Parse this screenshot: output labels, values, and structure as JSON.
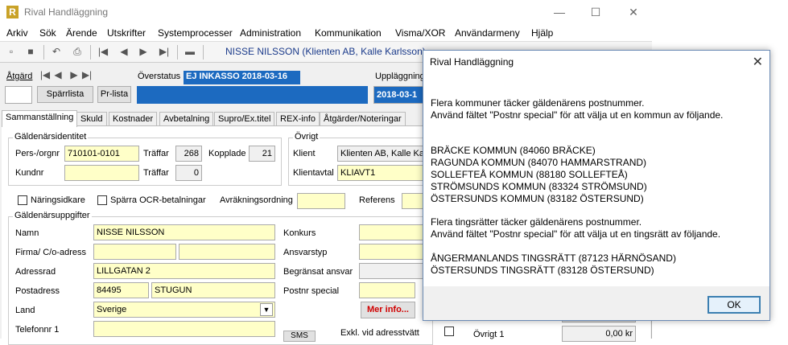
{
  "app": {
    "title": "Rival Handläggning",
    "logo_letter": "R"
  },
  "menu": [
    "Arkiv",
    "Sök",
    "Ärende",
    "Utskrifter",
    "Systemprocesser",
    "Administration",
    "Kommunikation",
    "Visma/XOR",
    "Användarmeny",
    "Hjälp"
  ],
  "toolbar": {
    "client_label": "NISSE NILSSON (Klienten AB, Kalle Karlsson)"
  },
  "header": {
    "atgard_label": "Åtgärd",
    "atgard_value": "",
    "sparrlista_button": "Spärrlista",
    "prlista_button": "Pr-lista",
    "overstatus_label": "Överstatus",
    "overstatus_value": "EJ INKASSO 2018-03-16",
    "upplaggning_label": "Uppläggning",
    "upplaggning_value": "2018-03-1"
  },
  "tabs": [
    "Sammanställning",
    "Skuld",
    "Kostnader",
    "Avbetalning",
    "Supro/Ex.titel",
    "REX-info",
    "Åtgärder/Noteringar"
  ],
  "identitet": {
    "group_title": "Gäldenärsidentitet",
    "persorgnr_label": "Pers-/orgnr",
    "persorgnr_value": "710101-0101",
    "traffar_label": "Träffar",
    "traffar_value": "268",
    "kopplade_label": "Kopplade",
    "kopplade_value": "21",
    "kundnr_label": "Kundnr",
    "kundnr_value": "",
    "traffar2_label": "Träffar",
    "traffar2_value": "0"
  },
  "ovrigt": {
    "group_title": "Övrigt",
    "klient_label": "Klient",
    "klient_value": "Klienten AB, Kalle Karl",
    "klientavtal_label": "Klientavtal",
    "klientavtal_value": "KLIAVT1"
  },
  "checks": {
    "naringsidkare": "Näringsidkare",
    "sparra_ocr": "Spärra OCR-betalningar",
    "avrakningsordning": "Avräkningsordning",
    "referens": "Referens"
  },
  "uppgifter": {
    "group_title": "Gäldenärsuppgifter",
    "namn_label": "Namn",
    "namn_value": "NISSE NILSSON",
    "firma_label": "Firma/ C/o-adress",
    "adressrad_label": "Adressrad",
    "adressrad_value": "LILLGATAN 2",
    "postadress_label": "Postadress",
    "postnr_value": "84495",
    "ort_value": "STUGUN",
    "land_label": "Land",
    "land_value": "Sverige",
    "telefon_label": "Telefonnr 1",
    "konkurs_label": "Konkurs",
    "ansvarstyp_label": "Ansvarstyp",
    "begransat_label": "Begränsat ansvar",
    "postnr_special_label": "Postnr special",
    "mer_info": "Mer info...",
    "exkl_label": "Exkl. vid adresstvätt",
    "sms_button": "SMS",
    "ovrigt1_label": "Övrigt 1",
    "ovrigt1_value": "0,00 kr"
  },
  "dialog": {
    "title": "Rival Handläggning",
    "lines": [
      "Flera kommuner täcker gäldenärens postnummer.",
      "Använd fältet \"Postnr special\" för att välja ut en kommun av följande.",
      "",
      "BRÄCKE KOMMUN (84060 BRÄCKE)",
      "RAGUNDA KOMMUN (84070 HAMMARSTRAND)",
      "SOLLEFTEÅ KOMMUN (88180 SOLLEFTEÅ)",
      "STRÖMSUNDS KOMMUN (83324 STRÖMSUND)",
      "ÖSTERSUNDS KOMMUN (83182 ÖSTERSUND)",
      "",
      "Flera tingsrätter täcker gäldenärens postnummer.",
      "Använd fältet \"Postnr special\" för att välja ut en tingsrätt av följande.",
      "",
      "ÅNGERMANLANDS TINGSRÄTT (87123 HÄRNÖSAND)",
      "ÖSTERSUNDS TINGSRÄTT (83128 ÖSTERSUND)"
    ],
    "ok_button": "OK"
  },
  "icons": {
    "minimize": "minimize-icon",
    "maximize": "maximize-icon",
    "close": "close-icon"
  }
}
